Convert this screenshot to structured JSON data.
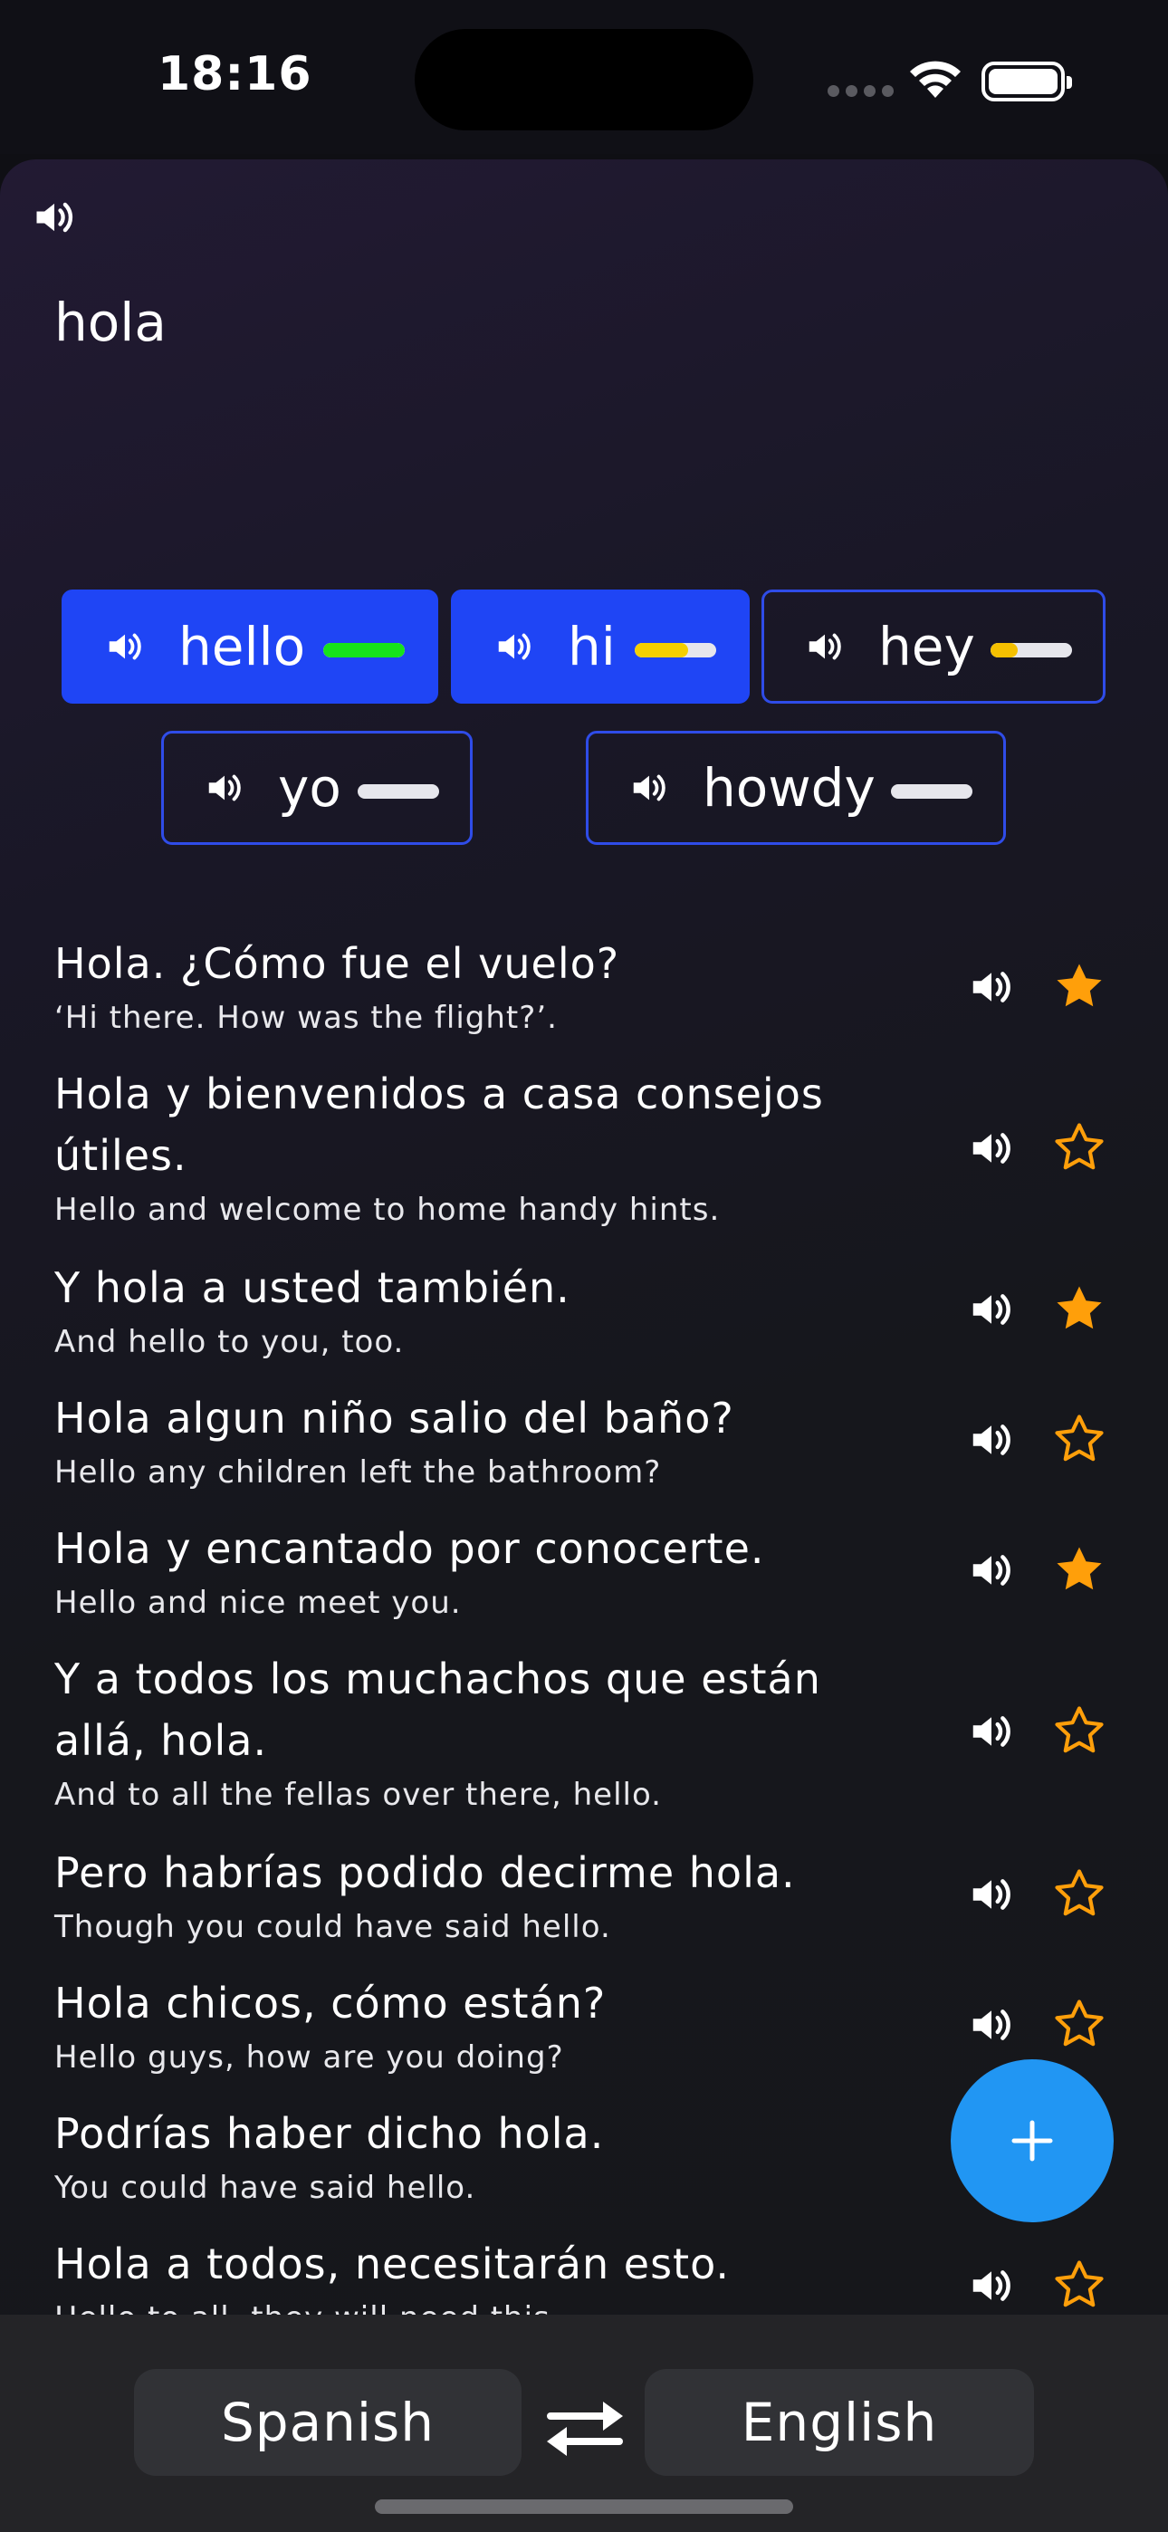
{
  "status_bar": {
    "time": "18:16"
  },
  "query": {
    "text": "hola"
  },
  "translations": [
    {
      "word": "hello",
      "selected": true,
      "confidence": 1.0,
      "bar_color": "#16e31b"
    },
    {
      "word": "hi",
      "selected": true,
      "confidence": 0.66,
      "bar_color": "#f5d000"
    },
    {
      "word": "hey",
      "selected": false,
      "confidence": 0.33,
      "bar_color": "#f5c000"
    },
    {
      "word": "yo",
      "selected": false,
      "confidence": 0.0,
      "bar_color": "#f5c000"
    },
    {
      "word": "howdy",
      "selected": false,
      "confidence": 0.0,
      "bar_color": "#f5c000"
    }
  ],
  "examples": [
    {
      "es": "Hola. ¿Cómo fue el vuelo?",
      "en": "‘Hi there. How was the flight?’.",
      "starred": true
    },
    {
      "es": "Hola y bienvenidos a casa consejos útiles.",
      "en": "Hello and welcome to home handy hints.",
      "starred": false
    },
    {
      "es": "Y hola a usted también.",
      "en": "And hello to you, too.",
      "starred": true
    },
    {
      "es": "Hola algun niño salio del baño?",
      "en": "Hello any children left the bathroom?",
      "starred": false
    },
    {
      "es": "Hola y encantado por conocerte.",
      "en": "Hello and nice meet you.",
      "starred": true
    },
    {
      "es": "Y a todos los muchachos que están allá, hola.",
      "en": "And to all the fellas over there, hello.",
      "starred": false
    },
    {
      "es": "Pero habrías podido decirme hola.",
      "en": "Though you could have said hello.",
      "starred": false
    },
    {
      "es": "Hola chicos, cómo están?",
      "en": "Hello guys, how are you doing?",
      "starred": false
    },
    {
      "es": "Podrías haber dicho hola.",
      "en": "You could have said hello.",
      "starred": false
    },
    {
      "es": "Hola a todos, necesitarán esto.",
      "en": "Hello to all, they will need this.",
      "starred": false
    }
  ],
  "languages": {
    "source": "Spanish",
    "target": "English"
  },
  "colors": {
    "accent": "#1f45f5",
    "star": "#ff9f0a",
    "fab": "#2196f3"
  },
  "icons": {
    "speaker": "speaker-icon",
    "star": "star-icon",
    "add": "plus-icon",
    "swap": "swap-arrows-icon"
  }
}
